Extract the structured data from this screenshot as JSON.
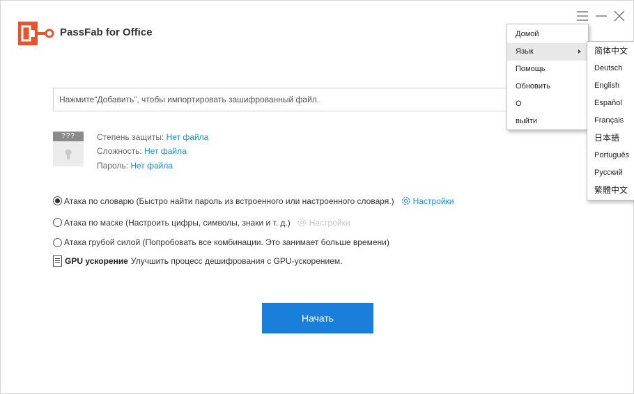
{
  "app": {
    "title": "PassFab for Office",
    "brand_color": "#e8532b",
    "accent_color": "#1a7fdb"
  },
  "window_controls": [
    "menu-icon",
    "minimize-icon",
    "close-icon"
  ],
  "file": {
    "placeholder": "Нажмите“Добавить”, чтобы импортировать зашифрованный файл.",
    "value": ""
  },
  "file_info": {
    "thumb_label": "???",
    "rows": [
      {
        "label": "Степень защиты:",
        "value": "Нет файла"
      },
      {
        "label": "Сложность:",
        "value": "Нет файла"
      },
      {
        "label": "Пароль:",
        "value": "Нет файла"
      }
    ]
  },
  "attacks": [
    {
      "label": "Атака по словарю (Быстро найти пароль из встроенного или настроенного словаря.)",
      "selected": true,
      "settings_label": "Настройки",
      "settings_enabled": true
    },
    {
      "label": "Атака по маске (Настроить цифры, символы, знаки и т. д.)",
      "selected": false,
      "settings_label": "Настройки",
      "settings_enabled": false
    },
    {
      "label": "Атака грубой силой (Попробовать все комбинации. Это занимает больше времени)",
      "selected": false
    }
  ],
  "gpu": {
    "title": "GPU ускорение",
    "description": "Улучшить процесс дешифрования с GPU-ускорением."
  },
  "start_button": "Начать",
  "main_menu": {
    "items": [
      "Домой",
      "Язык",
      "Помощь",
      "Обновить",
      "О",
      "выйти"
    ],
    "highlighted": "Язык"
  },
  "language_menu": {
    "items": [
      "简体中文",
      "Deutsch",
      "English",
      "Español",
      "Français",
      "日本語",
      "Português",
      "Русский",
      "繁體中文"
    ]
  }
}
